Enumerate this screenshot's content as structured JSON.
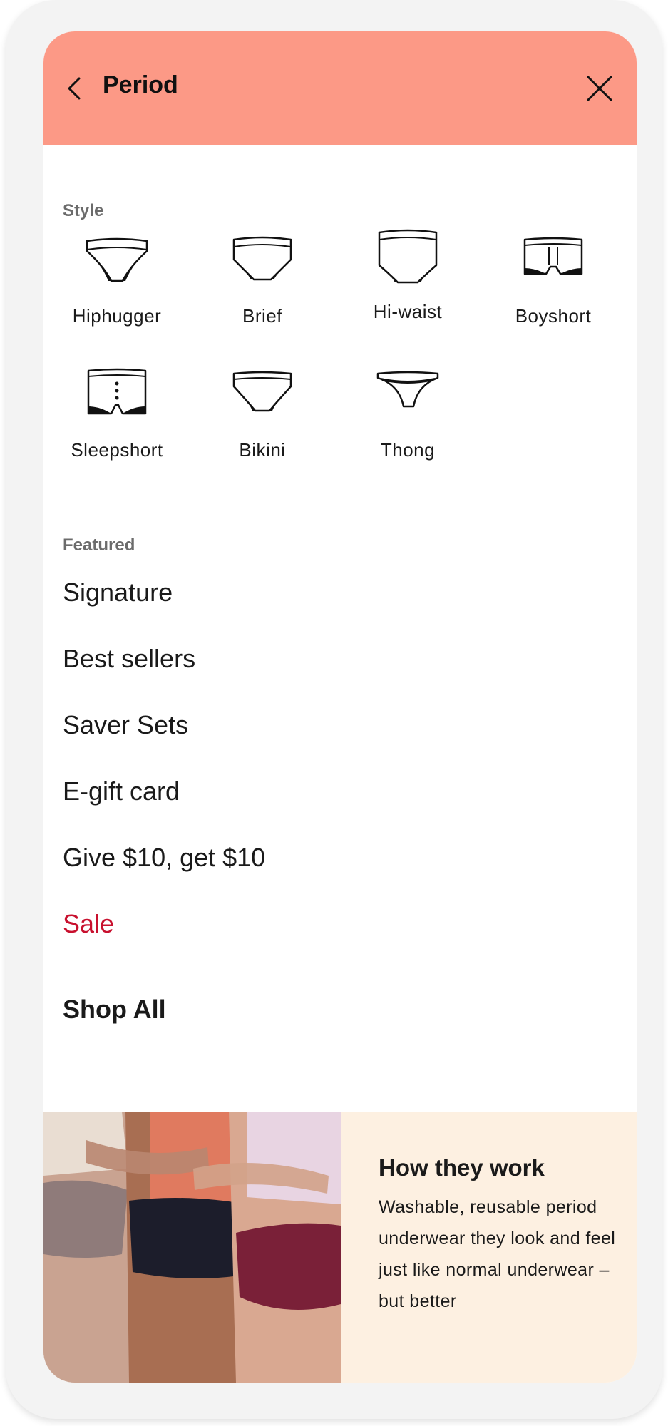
{
  "header": {
    "title": "Period",
    "background": "#fc9986",
    "back_icon": "chevron-left-icon",
    "close_icon": "close-icon"
  },
  "style_section": {
    "label": "Style",
    "items": [
      {
        "label": "Hiphugger",
        "icon": "hiphugger-icon"
      },
      {
        "label": "Brief",
        "icon": "brief-icon"
      },
      {
        "label": "Hi-waist",
        "icon": "hi-waist-icon"
      },
      {
        "label": "Boyshort",
        "icon": "boyshort-icon"
      },
      {
        "label": "Sleepshort",
        "icon": "sleepshort-icon"
      },
      {
        "label": "Bikini",
        "icon": "bikini-icon"
      },
      {
        "label": "Thong",
        "icon": "thong-icon"
      }
    ]
  },
  "featured_section": {
    "label": "Featured",
    "items": [
      {
        "label": "Signature"
      },
      {
        "label": "Best sellers"
      },
      {
        "label": "Saver Sets"
      },
      {
        "label": "E-gift card"
      },
      {
        "label": "Give $10, get $10"
      },
      {
        "label": "Sale",
        "color": "#c8102e"
      }
    ],
    "shop_all": "Shop All"
  },
  "promo": {
    "title": "How they work",
    "text": "Washable, reusable period underwear they look and feel just like normal underwear – but better",
    "background": "#fdf0e1"
  }
}
